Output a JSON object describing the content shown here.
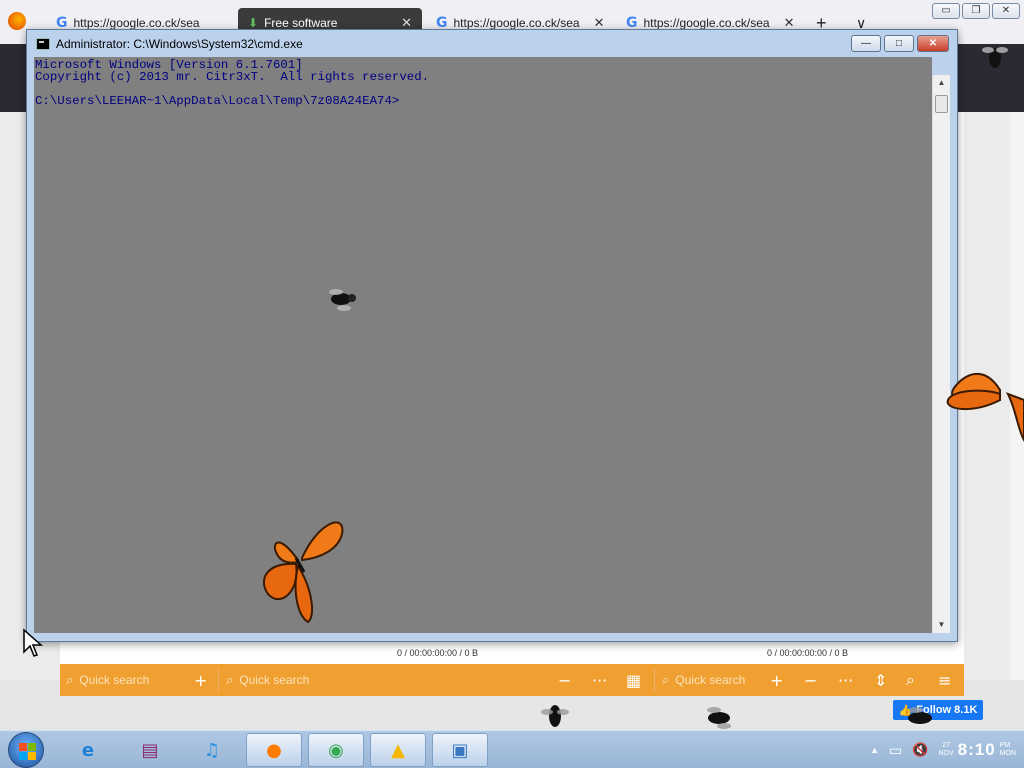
{
  "browser": {
    "tabs": [
      {
        "icon": "google-icon",
        "label": "https://google.co.ck/sea"
      },
      {
        "icon": "download-icon",
        "label": "Free software"
      },
      {
        "icon": "google-icon",
        "label": "https://google.co.ck/sea"
      },
      {
        "icon": "google-icon",
        "label": "https://google.co.ck/sea"
      }
    ],
    "new_tab_label": "+",
    "tab_list_label": "∨",
    "window_controls": {
      "minimize": "▭",
      "restore": "❐",
      "close": "✕"
    }
  },
  "app_bar": {
    "status_left": "0 / 00:00:00:00 / 0 B",
    "status_right": "0 / 00:00:00:00 / 0 B",
    "search_placeholder_1": "Quick search",
    "search_placeholder_2": "Quick search",
    "search_placeholder_3": "Quick search",
    "icons": {
      "add": "+",
      "minus": "−",
      "more": "···",
      "grid": "▦",
      "sort": "⇕",
      "search": "⌕",
      "menu": "≡"
    }
  },
  "cmd": {
    "title": "Administrator: C:\\Windows\\System32\\cmd.exe",
    "controls": {
      "minimize": "—",
      "maximize": "□",
      "close": "✕"
    },
    "lines": [
      "Microsoft Windows [Version 6.1.7601]",
      "Copyright (c) 2013 mr. Citr3xT.  All rights reserved.",
      "",
      "C:\\Users\\LEEHAR~1\\AppData\\Local\\Temp\\7z08A24EA74>"
    ],
    "scroll_up": "▲",
    "scroll_down": "▼"
  },
  "facebook": {
    "label": "Follow 8.1K"
  },
  "taskbar": {
    "apps": [
      {
        "name": "internet-explorer",
        "glyph": "e",
        "color": "#1e7fd6"
      },
      {
        "name": "winrar",
        "glyph": "▤",
        "color": "#8a2a6b"
      },
      {
        "name": "itunes",
        "glyph": "♫",
        "color": "#2a8fe0"
      },
      {
        "name": "firefox",
        "glyph": "●",
        "color": "#ff7a00"
      },
      {
        "name": "chrome",
        "glyph": "◉",
        "color": "#34a853"
      },
      {
        "name": "aimp",
        "glyph": "▲",
        "color": "#f5b800"
      },
      {
        "name": "remote-desktop",
        "glyph": "▣",
        "color": "#3a78c2"
      }
    ],
    "tray": {
      "arrow": "▲",
      "network": "▭",
      "volume": "🔇"
    },
    "clock": {
      "time": "8:10",
      "ampm": "PM",
      "day": "MON",
      "date_day": "27",
      "date_month": "NOV"
    }
  }
}
